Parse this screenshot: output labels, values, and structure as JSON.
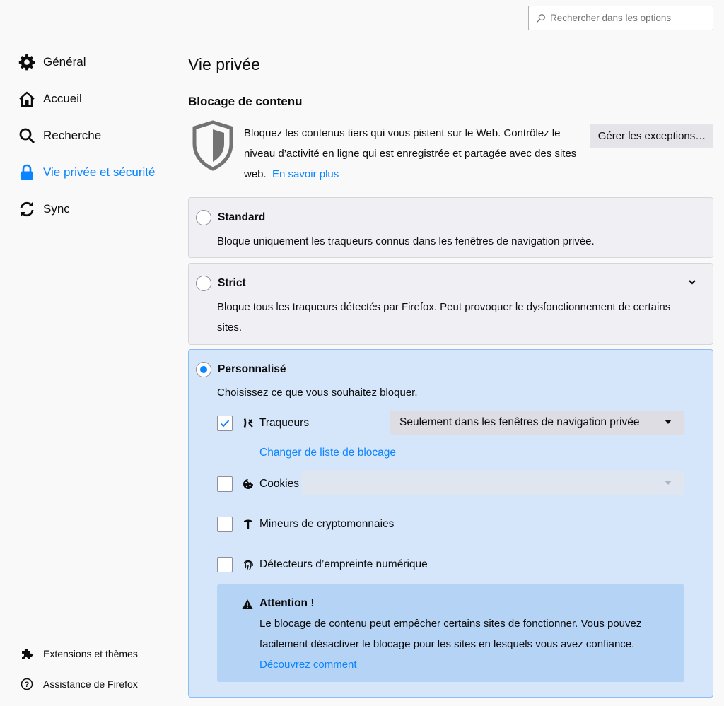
{
  "search": {
    "placeholder": "Rechercher dans les options"
  },
  "sidebar": {
    "items": [
      {
        "label": "Général",
        "icon": "gear-icon",
        "active": false
      },
      {
        "label": "Accueil",
        "icon": "home-icon",
        "active": false
      },
      {
        "label": "Recherche",
        "icon": "search-icon",
        "active": false
      },
      {
        "label": "Vie privée et sécurité",
        "icon": "lock-icon",
        "active": true
      },
      {
        "label": "Sync",
        "icon": "sync-icon",
        "active": false
      }
    ],
    "footer": [
      {
        "label": "Extensions et thèmes",
        "icon": "puzzle-icon"
      },
      {
        "label": "Assistance de Firefox",
        "icon": "help-icon"
      }
    ]
  },
  "page": {
    "title": "Vie privée"
  },
  "content_blocking": {
    "title": "Blocage de contenu",
    "description": "Bloquez les contenus tiers qui vous pistent sur le Web. Contrôlez le niveau d’activité en ligne qui est enregistrée et partagée avec des sites web.",
    "learn_more": "En savoir plus",
    "exceptions_button": "Gérer les exceptions…"
  },
  "options": {
    "standard": {
      "title": "Standard",
      "description": "Bloque uniquement les traqueurs connus dans les fenêtres de navigation privée.",
      "checked": false
    },
    "strict": {
      "title": "Strict",
      "description": "Bloque tous les traqueurs détectés par Firefox. Peut provoquer le dysfonctionnement de certains sites.",
      "checked": false
    },
    "custom": {
      "title": "Personnalisé",
      "description": "Choisissez ce que vous souhaitez bloquer.",
      "checked": true,
      "trackers": {
        "label": "Traqueurs",
        "checked": true,
        "select_value": "Seulement dans les fenêtres de navigation privée",
        "change_list_link": "Changer de liste de blocage"
      },
      "cookies": {
        "label": "Cookies",
        "checked": false,
        "select_value": ""
      },
      "cryptominers": {
        "label": "Mineurs de cryptomonnaies",
        "checked": false
      },
      "fingerprinters": {
        "label": "Détecteurs d’empreinte numérique",
        "checked": false
      },
      "warning": {
        "title": "Attention !",
        "text": "Le blocage de contenu peut empêcher certains sites de fonctionner. Vous pouvez facilement désactiver le blocage pour les sites en lesquels vous avez confiance.",
        "link": "Découvrez comment"
      }
    }
  },
  "colors": {
    "accent": "#0a84ff",
    "selected_bg": "#d6e6fa",
    "warning_bg": "#b5d3f5"
  }
}
